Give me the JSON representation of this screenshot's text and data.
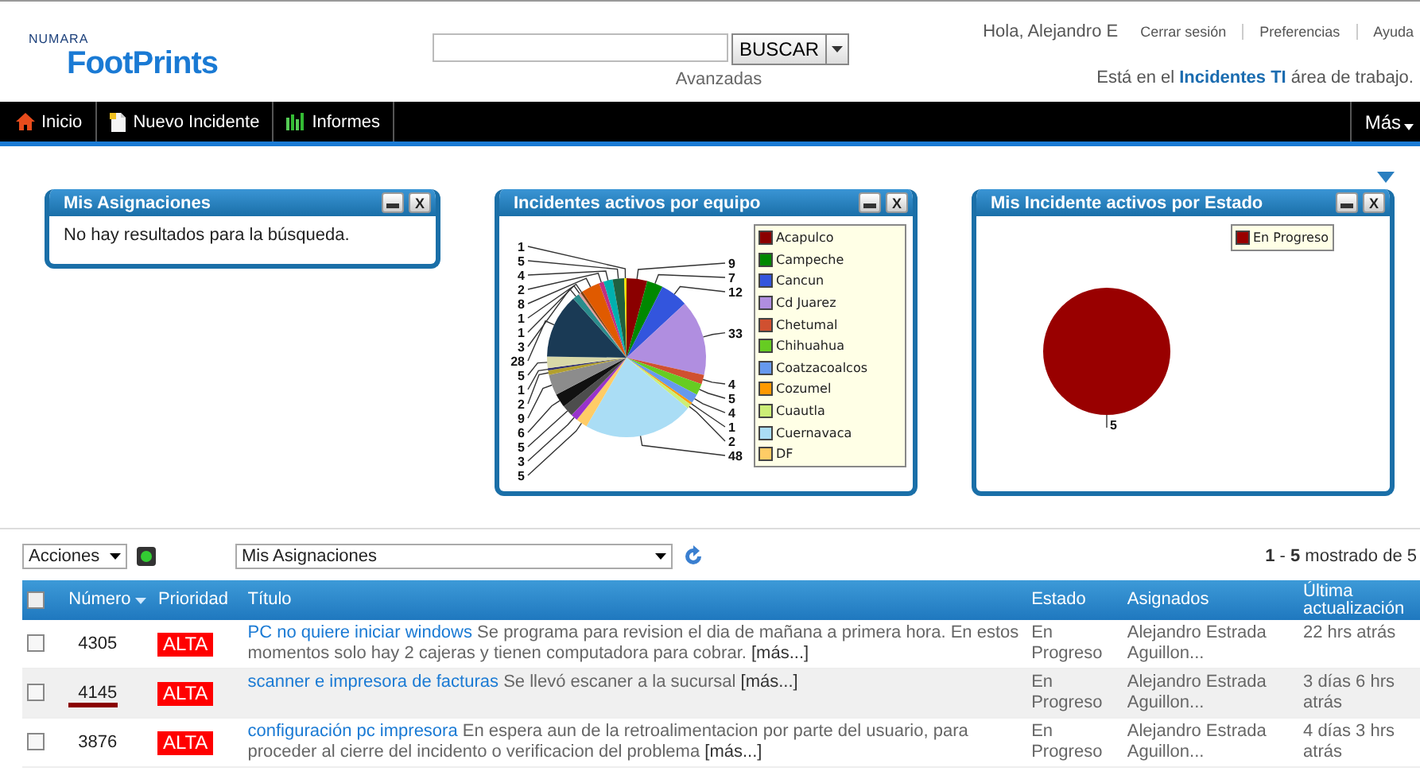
{
  "header": {
    "logo_small": "NUMARA",
    "logo": "FootPrints",
    "search": {
      "button": "BUSCAR",
      "advanced": "Avanzadas"
    },
    "greeting": "Hola, Alejandro E",
    "links": [
      "Cerrar sesión",
      "Preferencias",
      "Ayuda"
    ],
    "workspace": "Está en el **Incidentes TI** área de trabajo."
  },
  "nav": {
    "items": [
      {
        "label": "Inicio"
      },
      {
        "label": "Nuevo Incidente"
      },
      {
        "label": "Informes"
      }
    ],
    "more": "Más"
  },
  "portlets": [
    {
      "kind": "message",
      "title": "Mis Asignaciones",
      "close": "X",
      "message": "No hay resultados para la búsqueda."
    },
    {
      "kind": "pie",
      "title": "Incidentes activos por equipo",
      "close": "X",
      "chart_data": {
        "type": "pie",
        "values": [
          9,
          7,
          12,
          33,
          4,
          5,
          4,
          1,
          2,
          48,
          5,
          3,
          5,
          6,
          9,
          2,
          1,
          5,
          28,
          3,
          1,
          1,
          8,
          2,
          4,
          5,
          1
        ],
        "data_labels": true
      },
      "legend": [
        {
          "label": "Acapulco",
          "color": "#8b0000"
        },
        {
          "label": "Campeche",
          "color": "#008800"
        },
        {
          "label": "Cancun",
          "color": "#3355dd"
        },
        {
          "label": "Cd Juarez",
          "color": "#b08ee0"
        },
        {
          "label": "Chetumal",
          "color": "#d05030"
        },
        {
          "label": "Chihuahua",
          "color": "#66cc22"
        },
        {
          "label": "Coatzacoalcos",
          "color": "#6699ee"
        },
        {
          "label": "Cozumel",
          "color": "#ff9900"
        },
        {
          "label": "Cuautla",
          "color": "#ccee77"
        },
        {
          "label": "Cuernavaca",
          "color": "#aaddf5"
        },
        {
          "label": "DF",
          "color": "#ffcc66"
        }
      ]
    },
    {
      "kind": "pie",
      "title": "Mis Incidente activos por Estado",
      "close": "X",
      "chart_data": {
        "type": "pie",
        "values": [
          5
        ],
        "data_labels": true
      },
      "legend": [
        {
          "label": "En Progreso",
          "color": "#990000"
        }
      ]
    }
  ],
  "toolbar": {
    "actions": "Acciones",
    "view": "Mis Asignaciones",
    "paging": "**1** - **5** mostrado de 5"
  },
  "table": {
    "select_all_checked": false,
    "columns": [
      "Número",
      "Prioridad",
      "Título",
      "Estado",
      "Asignados",
      "Última actualización"
    ],
    "rows": [
      {
        "number": "4305",
        "priority": "ALTA",
        "link": "PC no quiere iniciar windows",
        "description": "Se programa para revision el dia de mañana a primera hora. En estos momentos solo hay 2 cajeras y tienen computadora para cobrar.",
        "more": "[más...]",
        "status": "En Progreso",
        "assigned": "Alejandro Estrada Aguillon...",
        "updated": "22 hrs atrás",
        "selected": false,
        "checked": false
      },
      {
        "number": "4145",
        "priority": "ALTA",
        "link": "scanner e impresora de facturas",
        "description": "Se llevó escaner a la sucursal",
        "more": "[más...]",
        "status": "En Progreso",
        "assigned": "Alejandro Estrada Aguillon...",
        "updated": "3 días 6 hrs atrás",
        "selected": true,
        "checked": false
      },
      {
        "number": "3876",
        "priority": "ALTA",
        "link": "configuración pc impresora",
        "description": "En espera aun de la retroalimentacion por parte del usuario, para proceder al cierre del incidento o verificacion del problema",
        "more": "[más...]",
        "status": "En Progreso",
        "assigned": "Alejandro Estrada Aguillon...",
        "updated": "4 días 3 hrs atrás",
        "selected": false,
        "checked": false
      }
    ]
  }
}
